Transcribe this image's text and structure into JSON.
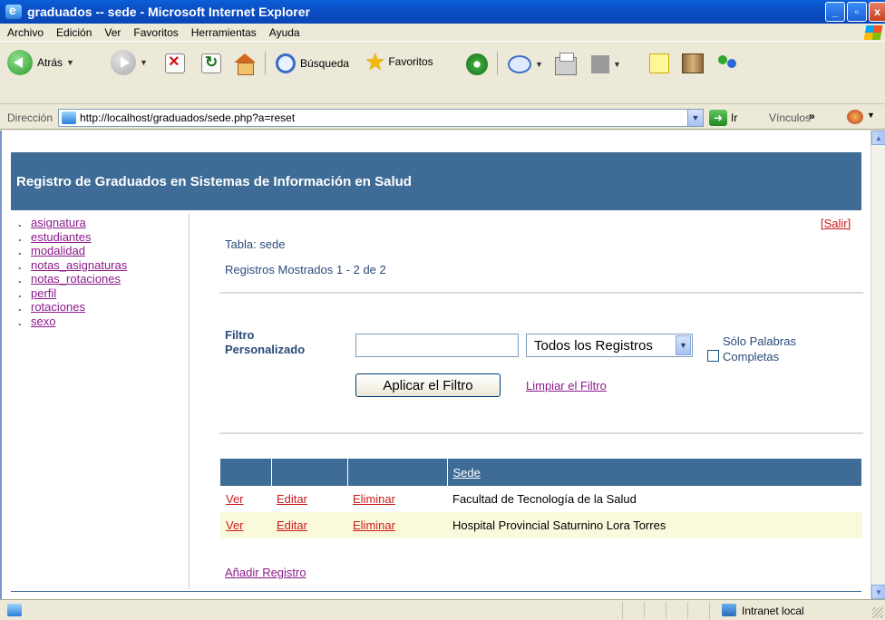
{
  "window": {
    "title": "graduados -- sede - Microsoft Internet Explorer",
    "controls": [
      "_",
      "▫",
      "x"
    ]
  },
  "menu": {
    "items": [
      "Archivo",
      "Edición",
      "Ver",
      "Favoritos",
      "Herramientas",
      "Ayuda"
    ]
  },
  "toolbar": {
    "back_label": "Atrás",
    "search_label": "Búsqueda",
    "favorites_label": "Favoritos"
  },
  "address": {
    "label": "Dirección",
    "url": "http://localhost/graduados/sede.php?a=reset",
    "go_label": "Ir",
    "links_label": "Vínculos",
    "links_chevron": "»"
  },
  "page": {
    "banner_title": "Registro de Graduados en Sistemas de Información en Salud",
    "bullet": ".",
    "nav": [
      "asignatura",
      "estudiantes",
      "modalidad",
      "notas_asignaturas",
      "notas_rotaciones",
      "perfil",
      "rotaciones",
      "sexo"
    ],
    "logout_label": "[Salir]",
    "table_label": "Tabla: sede",
    "records_label": "Registros Mostrados 1 - 2 de 2",
    "filter": {
      "label": "Filtro Personalizado",
      "input_value": "",
      "select_value": "Todos los Registros",
      "whole_words_label": "Sólo Palabras Completas",
      "apply_label": "Aplicar el Filtro",
      "clear_label": "Limpiar el Filtro"
    },
    "grid": {
      "headers": [
        "",
        "",
        "",
        "Sede"
      ],
      "rows": [
        {
          "view": "Ver",
          "edit": "Editar",
          "delete": "Eliminar",
          "sede": "Facultad de Tecnología de la Salud"
        },
        {
          "view": "Ver",
          "edit": "Editar",
          "delete": "Eliminar",
          "sede": "Hospital Provincial Saturnino Lora Torres"
        }
      ]
    },
    "add_label": "Añadir Registro"
  },
  "status": {
    "zone": "Intranet local"
  }
}
